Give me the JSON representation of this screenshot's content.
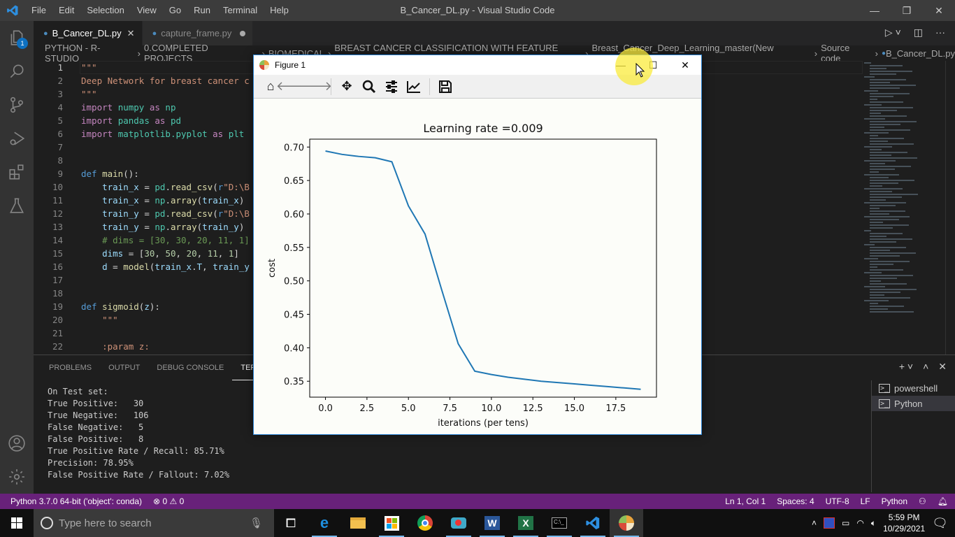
{
  "window": {
    "title": "B_Cancer_DL.py - Visual Studio Code",
    "menu": [
      "File",
      "Edit",
      "Selection",
      "View",
      "Go",
      "Run",
      "Terminal",
      "Help"
    ],
    "controls": {
      "minimize": "—",
      "restore": "❐",
      "close": "✕"
    }
  },
  "activity_bar": {
    "items": [
      {
        "name": "explorer-icon",
        "badge": "1"
      },
      {
        "name": "search-icon"
      },
      {
        "name": "source-control-icon"
      },
      {
        "name": "run-debug-icon"
      },
      {
        "name": "extensions-icon"
      },
      {
        "name": "testing-icon"
      }
    ],
    "bottom": [
      {
        "name": "account-icon"
      },
      {
        "name": "settings-gear-icon"
      }
    ]
  },
  "tabs": [
    {
      "label": "B_Cancer_DL.py",
      "active": true,
      "modified": false
    },
    {
      "label": "capture_frame.py",
      "active": false,
      "modified": true
    }
  ],
  "breadcrumb": [
    "PYTHON - R-STUDIO",
    "0.COMPLETED PROJECTS",
    "BIOMEDICAL",
    "BREAST CANCER CLASSIFICATION WITH FEATURE DATA",
    "Breast_Cancer_Deep_Learning_master(New Working)",
    "Source code",
    "B_Cancer_DL.py"
  ],
  "editor": {
    "lines": [
      {
        "n": "1",
        "tokens": [
          [
            "s",
            "\"\"\""
          ]
        ]
      },
      {
        "n": "2",
        "tokens": [
          [
            "s",
            "Deep Network for breast cancer c"
          ]
        ]
      },
      {
        "n": "3",
        "tokens": [
          [
            "s",
            "\"\"\""
          ]
        ]
      },
      {
        "n": "4",
        "tokens": [
          [
            "k",
            "import "
          ],
          [
            "mod",
            "numpy "
          ],
          [
            "k",
            "as "
          ],
          [
            "mod",
            "np"
          ]
        ]
      },
      {
        "n": "5",
        "tokens": [
          [
            "k",
            "import "
          ],
          [
            "mod",
            "pandas "
          ],
          [
            "k",
            "as "
          ],
          [
            "mod",
            "pd"
          ]
        ]
      },
      {
        "n": "6",
        "tokens": [
          [
            "k",
            "import "
          ],
          [
            "mod",
            "matplotlib.pyplot "
          ],
          [
            "k",
            "as "
          ],
          [
            "mod",
            "plt"
          ]
        ]
      },
      {
        "n": "7",
        "tokens": []
      },
      {
        "n": "8",
        "tokens": []
      },
      {
        "n": "9",
        "tokens": [
          [
            "d",
            "def "
          ],
          [
            "f",
            "main"
          ],
          [
            "p",
            "():"
          ]
        ]
      },
      {
        "n": "10",
        "tokens": [
          [
            "p",
            "    "
          ],
          [
            "v",
            "train_x"
          ],
          [
            "p",
            " = "
          ],
          [
            "mod",
            "pd"
          ],
          [
            "p",
            "."
          ],
          [
            "f",
            "read_csv"
          ],
          [
            "p",
            "("
          ],
          [
            "d",
            "r"
          ],
          [
            "s",
            "\"D:\\B"
          ]
        ]
      },
      {
        "n": "11",
        "tokens": [
          [
            "p",
            "    "
          ],
          [
            "v",
            "train_x"
          ],
          [
            "p",
            " = "
          ],
          [
            "mod",
            "np"
          ],
          [
            "p",
            "."
          ],
          [
            "f",
            "array"
          ],
          [
            "p",
            "("
          ],
          [
            "v",
            "train_x"
          ],
          [
            "p",
            ")"
          ]
        ]
      },
      {
        "n": "12",
        "tokens": [
          [
            "p",
            "    "
          ],
          [
            "v",
            "train_y"
          ],
          [
            "p",
            " = "
          ],
          [
            "mod",
            "pd"
          ],
          [
            "p",
            "."
          ],
          [
            "f",
            "read_csv"
          ],
          [
            "p",
            "("
          ],
          [
            "d",
            "r"
          ],
          [
            "s",
            "\"D:\\B"
          ]
        ]
      },
      {
        "n": "13",
        "tokens": [
          [
            "p",
            "    "
          ],
          [
            "v",
            "train_y"
          ],
          [
            "p",
            " = "
          ],
          [
            "mod",
            "np"
          ],
          [
            "p",
            "."
          ],
          [
            "f",
            "array"
          ],
          [
            "p",
            "("
          ],
          [
            "v",
            "train_y"
          ],
          [
            "p",
            ")"
          ]
        ]
      },
      {
        "n": "14",
        "tokens": [
          [
            "p",
            "    "
          ],
          [
            "c",
            "# dims = [30, 30, 20, 11, 1]"
          ]
        ]
      },
      {
        "n": "15",
        "tokens": [
          [
            "p",
            "    "
          ],
          [
            "v",
            "dims"
          ],
          [
            "p",
            " = ["
          ],
          [
            "n",
            "30"
          ],
          [
            "p",
            ", "
          ],
          [
            "n",
            "50"
          ],
          [
            "p",
            ", "
          ],
          [
            "n",
            "20"
          ],
          [
            "p",
            ", "
          ],
          [
            "n",
            "11"
          ],
          [
            "p",
            ", "
          ],
          [
            "n",
            "1"
          ],
          [
            "p",
            "]"
          ]
        ]
      },
      {
        "n": "16",
        "tokens": [
          [
            "p",
            "    "
          ],
          [
            "v",
            "d"
          ],
          [
            "p",
            " = "
          ],
          [
            "f",
            "model"
          ],
          [
            "p",
            "("
          ],
          [
            "v",
            "train_x"
          ],
          [
            "p",
            "."
          ],
          [
            "v",
            "T"
          ],
          [
            "p",
            ", "
          ],
          [
            "v",
            "train_y"
          ]
        ]
      },
      {
        "n": "17",
        "tokens": []
      },
      {
        "n": "18",
        "tokens": []
      },
      {
        "n": "19",
        "tokens": [
          [
            "d",
            "def "
          ],
          [
            "f",
            "sigmoid"
          ],
          [
            "p",
            "("
          ],
          [
            "v",
            "z"
          ],
          [
            "p",
            "):"
          ]
        ]
      },
      {
        "n": "20",
        "tokens": [
          [
            "p",
            "    "
          ],
          [
            "s",
            "\"\"\""
          ]
        ]
      },
      {
        "n": "21",
        "tokens": []
      },
      {
        "n": "22",
        "tokens": [
          [
            "p",
            "    "
          ],
          [
            "s",
            ":param z:"
          ]
        ]
      }
    ]
  },
  "panel": {
    "tabs": [
      "PROBLEMS",
      "OUTPUT",
      "DEBUG CONSOLE",
      "TERMINAL"
    ],
    "active_tab": "TERMINAL",
    "terminal_lines": [
      "On Test set:",
      "True Positive:   30",
      "True Negative:   106",
      "False Negative:   5",
      "False Positive:   8",
      "True Positive Rate / Recall: 85.71%",
      "Precision: 78.95%",
      "False Positive Rate / Fallout: 7.02%"
    ],
    "terminals": [
      {
        "label": "powershell",
        "selected": false
      },
      {
        "label": "Python",
        "selected": true
      }
    ]
  },
  "statusbar": {
    "interpreter": "Python 3.7.0 64-bit ('object': conda)",
    "errors": "0",
    "warnings": "0",
    "position": "Ln 1, Col 1",
    "spaces": "Spaces: 4",
    "encoding": "UTF-8",
    "eol": "LF",
    "language": "Python",
    "color": "#68217a"
  },
  "figure": {
    "title": "Figure 1",
    "toolbar": [
      "home-icon",
      "back-arrow-icon",
      "forward-arrow-icon",
      "pan-move-icon",
      "zoom-magnifier-icon",
      "configure-subplots-icon",
      "edit-axis-icon",
      "save-disk-icon"
    ]
  },
  "chart_data": {
    "type": "line",
    "title": "Learning rate =0.009",
    "xlabel": "iterations (per tens)",
    "ylabel": "cost",
    "x": [
      0,
      1,
      2,
      3,
      4,
      5,
      6,
      7,
      8,
      9,
      10,
      11,
      12,
      13,
      14,
      15,
      16,
      17,
      18,
      19
    ],
    "series": [
      {
        "name": "cost",
        "color": "#1f77b4",
        "values": [
          0.694,
          0.689,
          0.686,
          0.684,
          0.678,
          0.612,
          0.57,
          0.487,
          0.406,
          0.365,
          0.36,
          0.356,
          0.353,
          0.35,
          0.348,
          0.346,
          0.344,
          0.342,
          0.34,
          0.338
        ]
      }
    ],
    "xlim": [
      -0.95,
      19.95
    ],
    "ylim": [
      0.3262,
      0.7118
    ],
    "xticks": [
      0.0,
      2.5,
      5.0,
      7.5,
      10.0,
      12.5,
      15.0,
      17.5
    ],
    "xtick_labels": [
      "0.0",
      "2.5",
      "5.0",
      "7.5",
      "10.0",
      "12.5",
      "15.0",
      "17.5"
    ],
    "yticks": [
      0.35,
      0.4,
      0.45,
      0.5,
      0.55,
      0.6,
      0.65,
      0.7
    ],
    "ytick_labels": [
      "0.35",
      "0.40",
      "0.45",
      "0.50",
      "0.55",
      "0.60",
      "0.65",
      "0.70"
    ],
    "grid": false,
    "legend": "none"
  },
  "taskbar": {
    "search_placeholder": "Type here to search",
    "apps": [
      "task-view-icon",
      "edge-icon",
      "file-explorer-icon",
      "store-icon",
      "chrome-icon",
      "screen-recorder-icon",
      "word-icon",
      "excel-icon",
      "cmd-icon",
      "vscode-icon",
      "matplotlib-figure-icon"
    ],
    "time": "5:59 PM",
    "date": "10/29/2021"
  }
}
